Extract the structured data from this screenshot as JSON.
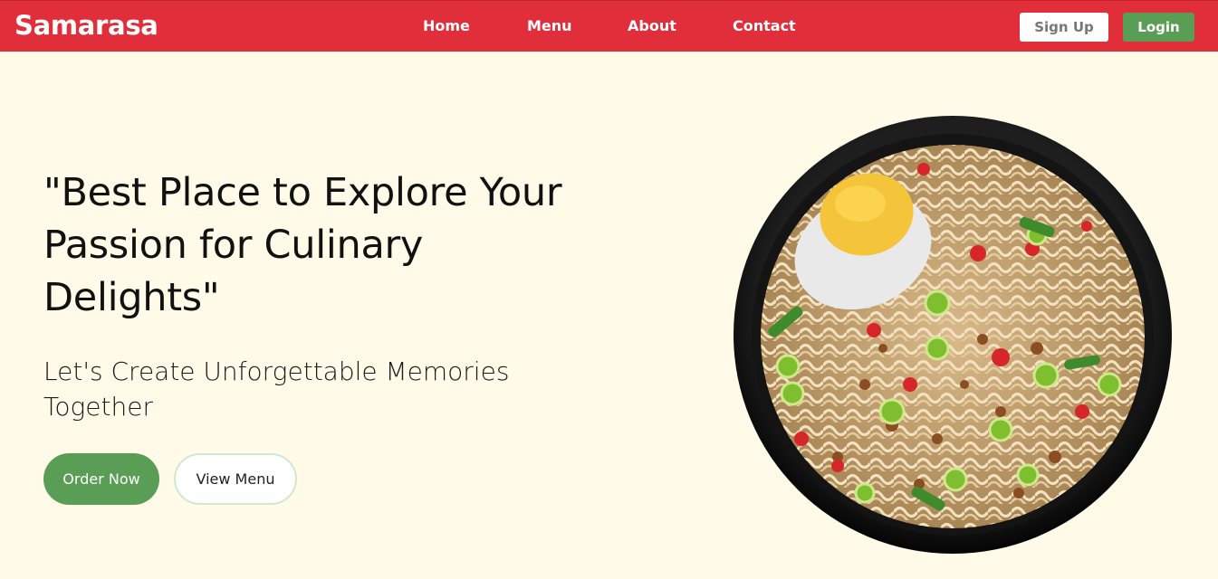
{
  "navbar": {
    "brand": "Samarasa",
    "links": [
      {
        "label": "Home"
      },
      {
        "label": "Menu"
      },
      {
        "label": "About"
      },
      {
        "label": "Contact"
      }
    ],
    "signup_label": "Sign Up",
    "login_label": "Login"
  },
  "hero": {
    "title_line1": "\"Best Place to Explore Your",
    "title_line2": "Passion for Culinary",
    "title_line3": "Delights\"",
    "subtitle_line1": "Let's Create Unforgettable Memories",
    "subtitle_line2": "Together",
    "order_label": "Order Now",
    "view_menu_label": "View Menu",
    "image_icon": "noodle-bowl-image"
  },
  "colors": {
    "navbar_bg": "#e02f3a",
    "page_bg": "#fffbe8",
    "accent_green": "#5a9e56"
  }
}
